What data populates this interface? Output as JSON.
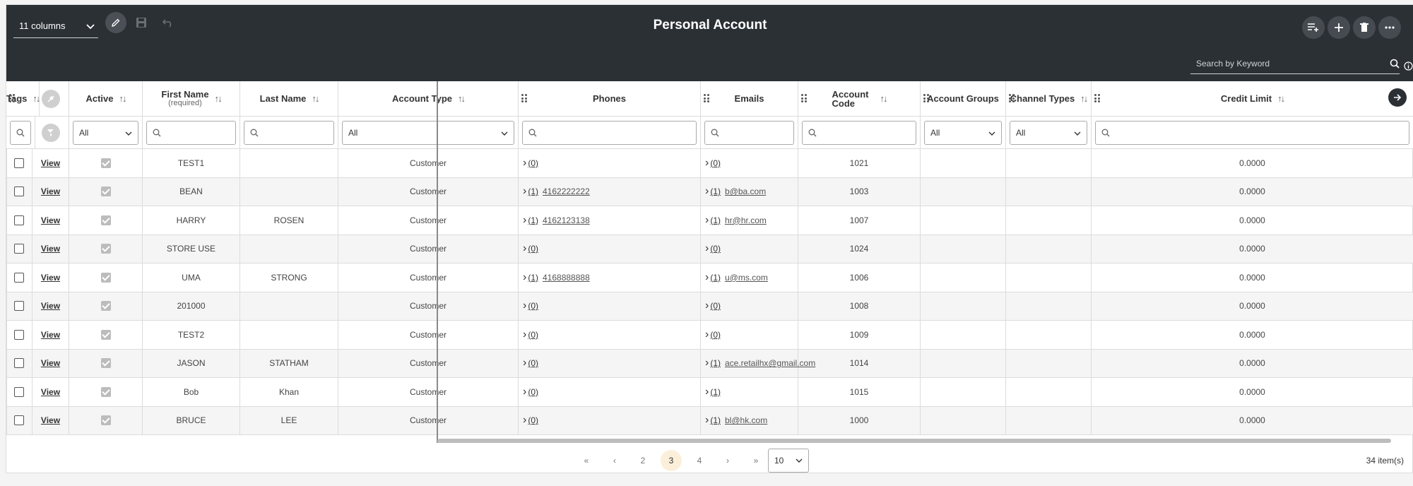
{
  "toolbar": {
    "columns_label": "11 columns",
    "title": "Personal Account",
    "search_placeholder": "Search by Keyword"
  },
  "columns": [
    {
      "key": "active",
      "label": "Active",
      "sub": "",
      "filter": "select",
      "filter_value": "All"
    },
    {
      "key": "first_name",
      "label": "First Name",
      "sub": "(required)",
      "filter": "input"
    },
    {
      "key": "last_name",
      "label": "Last Name",
      "sub": "",
      "filter": "input"
    },
    {
      "key": "account_type",
      "label": "Account Type",
      "sub": "",
      "filter": "select",
      "filter_value": "All"
    },
    {
      "key": "phones",
      "label": "Phones",
      "sub": "",
      "filter": "input"
    },
    {
      "key": "emails",
      "label": "Emails",
      "sub": "",
      "filter": "input"
    },
    {
      "key": "account_code",
      "label": "Account Code",
      "sub": "",
      "filter": "input"
    },
    {
      "key": "account_groups",
      "label": "Account Groups",
      "sub": "",
      "filter": "select",
      "filter_value": "All"
    },
    {
      "key": "channel_types",
      "label": "Channel Types",
      "sub": "",
      "filter": "select",
      "filter_value": "All"
    },
    {
      "key": "credit_limit",
      "label": "Credit Limit",
      "sub": "",
      "filter": "input"
    },
    {
      "key": "tags",
      "label": "Tags",
      "sub": "",
      "filter": "input"
    }
  ],
  "view_label": "View",
  "rows": [
    {
      "first": "TEST1",
      "last": "",
      "type": "Customer",
      "phone_count": "(0)",
      "phone": "",
      "email_count": "(0)",
      "email": "",
      "code": "1021",
      "credit": "0.0000"
    },
    {
      "first": "BEAN",
      "last": "",
      "type": "Customer",
      "phone_count": "(1)",
      "phone": "4162222222",
      "email_count": "(1)",
      "email": "b@ba.com",
      "code": "1003",
      "credit": "0.0000"
    },
    {
      "first": "HARRY",
      "last": "ROSEN",
      "type": "Customer",
      "phone_count": "(1)",
      "phone": "4162123138",
      "email_count": "(1)",
      "email": "hr@hr.com",
      "code": "1007",
      "credit": "0.0000"
    },
    {
      "first": "STORE USE",
      "last": "",
      "type": "Customer",
      "phone_count": "(0)",
      "phone": "",
      "email_count": "(0)",
      "email": "",
      "code": "1024",
      "credit": "0.0000"
    },
    {
      "first": "UMA",
      "last": "STRONG",
      "type": "Customer",
      "phone_count": "(1)",
      "phone": "4168888888",
      "email_count": "(1)",
      "email": "u@ms.com",
      "code": "1006",
      "credit": "0.0000"
    },
    {
      "first": "201000",
      "last": "",
      "type": "Customer",
      "phone_count": "(0)",
      "phone": "",
      "email_count": "(0)",
      "email": "",
      "code": "1008",
      "credit": "0.0000"
    },
    {
      "first": "TEST2",
      "last": "",
      "type": "Customer",
      "phone_count": "(0)",
      "phone": "",
      "email_count": "(0)",
      "email": "",
      "code": "1009",
      "credit": "0.0000"
    },
    {
      "first": "JASON",
      "last": "STATHAM",
      "type": "Customer",
      "phone_count": "(0)",
      "phone": "",
      "email_count": "(1)",
      "email": "ace.retailhx@gmail.com",
      "code": "1014",
      "credit": "0.0000"
    },
    {
      "first": "Bob",
      "last": "Khan",
      "type": "Customer",
      "phone_count": "(0)",
      "phone": "",
      "email_count": "(1)",
      "email": "",
      "code": "1015",
      "credit": "0.0000"
    },
    {
      "first": "BRUCE",
      "last": "LEE",
      "type": "Customer",
      "phone_count": "(0)",
      "phone": "",
      "email_count": "(1)",
      "email": "bl@hk.com",
      "code": "1000",
      "credit": "0.0000"
    }
  ],
  "pager": {
    "pages": [
      "2",
      "3",
      "4"
    ],
    "current": "3",
    "page_size": "10",
    "items_label": "34 item(s)"
  }
}
